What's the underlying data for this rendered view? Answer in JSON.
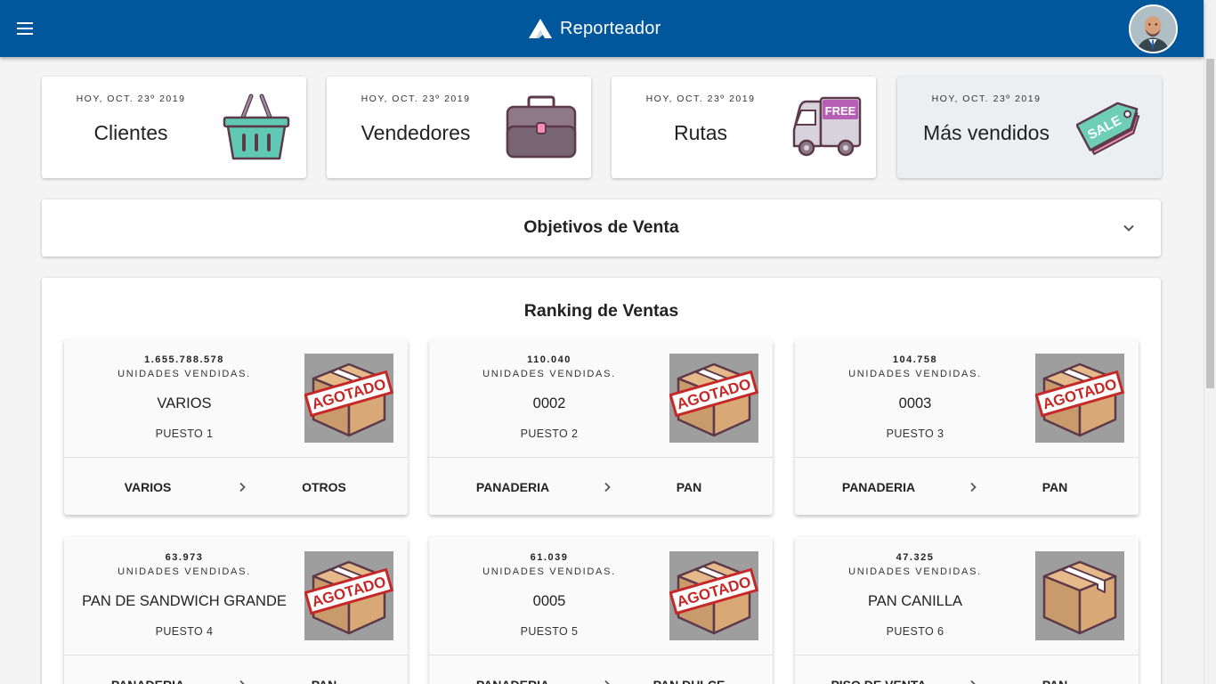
{
  "app": {
    "title": "Reporteador"
  },
  "stat_cards": [
    {
      "date": "HOY, OCT. 23º 2019",
      "title": "Clientes",
      "icon": "basket-icon"
    },
    {
      "date": "HOY, OCT. 23º 2019",
      "title": "Vendedores",
      "icon": "briefcase-icon"
    },
    {
      "date": "HOY, OCT. 23º 2019",
      "title": "Rutas",
      "icon": "delivery-truck-icon",
      "badge": "FREE"
    },
    {
      "date": "HOY, OCT. 23º 2019",
      "title": "Más vendidos",
      "icon": "sale-tag-icon",
      "badge": "SALE",
      "active": true
    }
  ],
  "objetivos": {
    "title": "Objetivos de Venta"
  },
  "ranking": {
    "title": "Ranking de Ventas",
    "unit_label": "UNIDADES VENDIDAS.",
    "stamp": "AGOTADO",
    "items": [
      {
        "value": "1.655.788.578",
        "name": "VARIOS",
        "position": "PUESTO 1",
        "category": "VARIOS",
        "subcategory": "OTROS",
        "sold_out": true
      },
      {
        "value": "110.040",
        "name": "0002",
        "position": "PUESTO 2",
        "category": "PANADERIA",
        "subcategory": "PAN",
        "sold_out": true
      },
      {
        "value": "104.758",
        "name": "0003",
        "position": "PUESTO 3",
        "category": "PANADERIA",
        "subcategory": "PAN",
        "sold_out": true
      },
      {
        "value": "63.973",
        "name": "PAN DE SANDWICH GRANDE",
        "position": "PUESTO 4",
        "category": "PANADERIA",
        "subcategory": "PAN",
        "sold_out": true
      },
      {
        "value": "61.039",
        "name": "0005",
        "position": "PUESTO 5",
        "category": "PANADERIA",
        "subcategory": "PAN DULCE",
        "sold_out": true
      },
      {
        "value": "47.325",
        "name": "PAN CANILLA",
        "position": "PUESTO 6",
        "category": "PISO DE VENTA",
        "subcategory": "PAN",
        "sold_out": false
      }
    ]
  },
  "colors": {
    "appbar": "#01579b",
    "background": "#f4f4f4",
    "stamp_red": "#c62828"
  }
}
